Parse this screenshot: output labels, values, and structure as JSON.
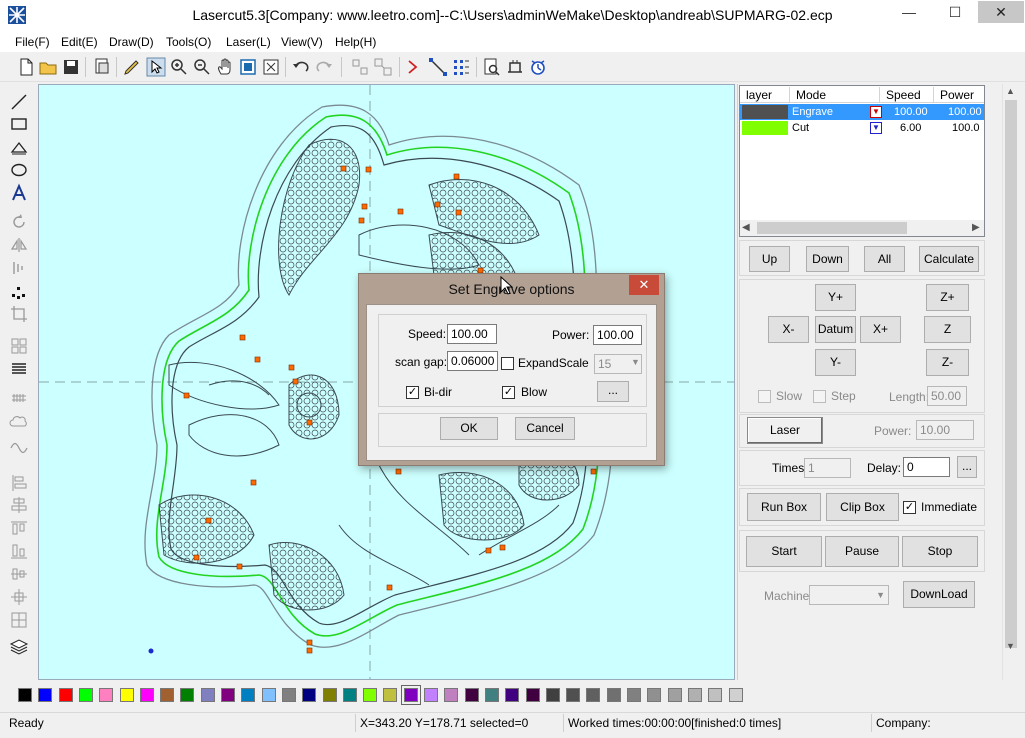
{
  "window": {
    "title": "Lasercut5.3[Company: www.leetro.com]--C:\\Users\\adminWeMake\\Desktop\\andreab\\SUPMARG-02.ecp",
    "min": "—",
    "max": "☐",
    "close": "✕"
  },
  "menu": [
    "File(F)",
    "Edit(E)",
    "Draw(D)",
    "Tools(O)",
    "Laser(L)",
    "View(V)",
    "Help(H)"
  ],
  "toolbar_icons": [
    "new-file-icon",
    "open-folder-icon",
    "save-icon",
    "import-icon",
    "pen-icon",
    "select-arrow-icon",
    "zoom-in-icon",
    "zoom-out-icon",
    "pan-hand-icon",
    "zoom-page-icon",
    "zoom-fit-icon",
    "undo-icon",
    "redo-icon",
    "group-icon",
    "ungroup-icon",
    "laser-path-icon",
    "node-edit-icon",
    "array-icon",
    "preview-icon",
    "simulate-icon",
    "timer-icon"
  ],
  "left_tools": [
    "line-icon",
    "rect-icon",
    "eraser-icon",
    "ellipse-icon",
    "text-icon",
    "rotate-icon",
    "mirror-h-icon",
    "mirror-v-icon",
    "node-icon",
    "crop-icon",
    "grid-icon",
    "fill-icon",
    "hatch-icon",
    "cloud-icon",
    "wave-icon",
    "align-left-icon",
    "align-center-icon",
    "align-top-icon",
    "align-bottom-icon",
    "align-middle-icon",
    "distribute-icon",
    "snap-icon",
    "layers-icon"
  ],
  "layers": {
    "headers": [
      "layer",
      "Mode",
      "Speed",
      "Power"
    ],
    "rows": [
      {
        "color": "#505050",
        "mode": "Engrave",
        "speed": "100.00",
        "power": "100.00",
        "selected": true
      },
      {
        "color": "#80ff00",
        "mode": "Cut",
        "speed": "6.00",
        "power": "100.0",
        "selected": false
      }
    ]
  },
  "layer_buttons": {
    "up": "Up",
    "down": "Down",
    "all": "All",
    "calculate": "Calculate"
  },
  "motion": {
    "y_plus": "Y+",
    "x_minus": "X-",
    "datum": "Datum",
    "x_plus": "X+",
    "y_minus": "Y-",
    "z_plus": "Z+",
    "z_datum": "Z Datum",
    "z_minus": "Z-",
    "slow": "Slow",
    "step": "Step",
    "length_label": "Length:",
    "length_value": "50.00"
  },
  "laser": {
    "button": "Laser",
    "power_label": "Power:",
    "power_value": "10.00"
  },
  "times": {
    "label": "Times:",
    "value": "1",
    "delay_label": "Delay:",
    "delay_value": "0",
    "more": "..."
  },
  "box": {
    "run": "Run Box",
    "clip": "Clip Box",
    "immediate": "Immediate"
  },
  "control": {
    "start": "Start",
    "pause": "Pause",
    "stop": "Stop"
  },
  "machine": {
    "label": "Machine:",
    "download": "DownLoad"
  },
  "palette": [
    "#000000",
    "#0000ff",
    "#ff0000",
    "#00ff00",
    "#ff80c0",
    "#ffff00",
    "#ff00ff",
    "#a06030",
    "#008000",
    "#8080c0",
    "#800080",
    "#0080c0",
    "#80c0ff",
    "#808080",
    "#000080",
    "#808000",
    "#008080",
    "#80ff00",
    "#c0c040",
    "#8000c0",
    "#c080ff",
    "#c080c0",
    "#400040",
    "#408080",
    "#400080",
    "#400040",
    "#404040",
    "#505050",
    "#606060",
    "#707070",
    "#808080",
    "#909090",
    "#a0a0a0",
    "#b0b0b0",
    "#c0c0c0",
    "#d0d0d0"
  ],
  "status": {
    "ready": "Ready",
    "coords": "X=343.20 Y=178.71 selected=0",
    "worked": "Worked times:00:00:00[finished:0 times]",
    "company": "Company:"
  },
  "dialog": {
    "title": "Set Engrave options",
    "close": "✕",
    "speed_label": "Speed:",
    "speed_value": "100.00",
    "power_label": "Power:",
    "power_value": "100.00",
    "scangap_label": "scan gap:",
    "scangap_value": "0.06000",
    "expandscale_label": "ExpandScale",
    "expandscale_value": "15",
    "bidir_label": "Bi-dir",
    "blow_label": "Blow",
    "more": "...",
    "ok": "OK",
    "cancel": "Cancel"
  }
}
